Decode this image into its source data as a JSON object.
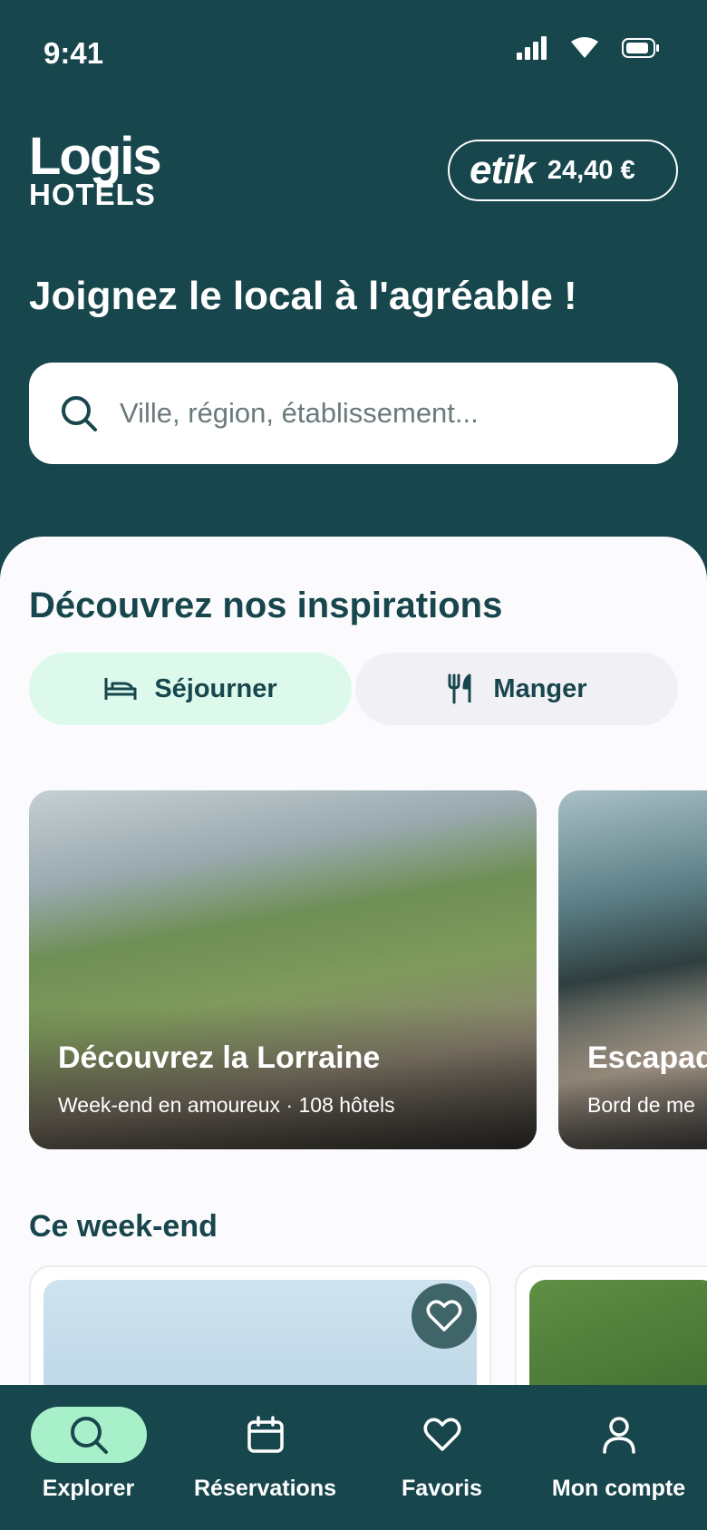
{
  "status": {
    "time": "9:41"
  },
  "header": {
    "logo_line1": "Logis",
    "logo_line2": "HOTELS",
    "wallet": {
      "brand": "etik",
      "amount": "24,40 €"
    },
    "headline": "Joignez le local à l'agréable !"
  },
  "search": {
    "placeholder": "Ville, région, établissement..."
  },
  "inspirations": {
    "title": "Découvrez nos inspirations",
    "segments": [
      {
        "label": "Séjourner",
        "icon": "bed-icon",
        "active": true
      },
      {
        "label": "Manger",
        "icon": "fork-knife-icon",
        "active": false
      }
    ],
    "cards": [
      {
        "title": "Découvrez la Lorraine",
        "subtitle": "Week-end en amoureux · 108 hôtels"
      },
      {
        "title": "Escapad",
        "subtitle": "Bord de me"
      }
    ]
  },
  "weekend": {
    "title": "Ce week-end"
  },
  "tabbar": {
    "items": [
      {
        "label": "Explorer",
        "icon": "search-icon",
        "active": true
      },
      {
        "label": "Réservations",
        "icon": "calendar-icon",
        "active": false
      },
      {
        "label": "Favoris",
        "icon": "heart-icon",
        "active": false
      },
      {
        "label": "Mon compte",
        "icon": "user-icon",
        "active": false
      }
    ]
  },
  "colors": {
    "primary": "#17464c",
    "accent_mint": "#a8f0c9",
    "segment_active": "#dcf9ec",
    "segment_inactive": "#f1f1f5"
  }
}
